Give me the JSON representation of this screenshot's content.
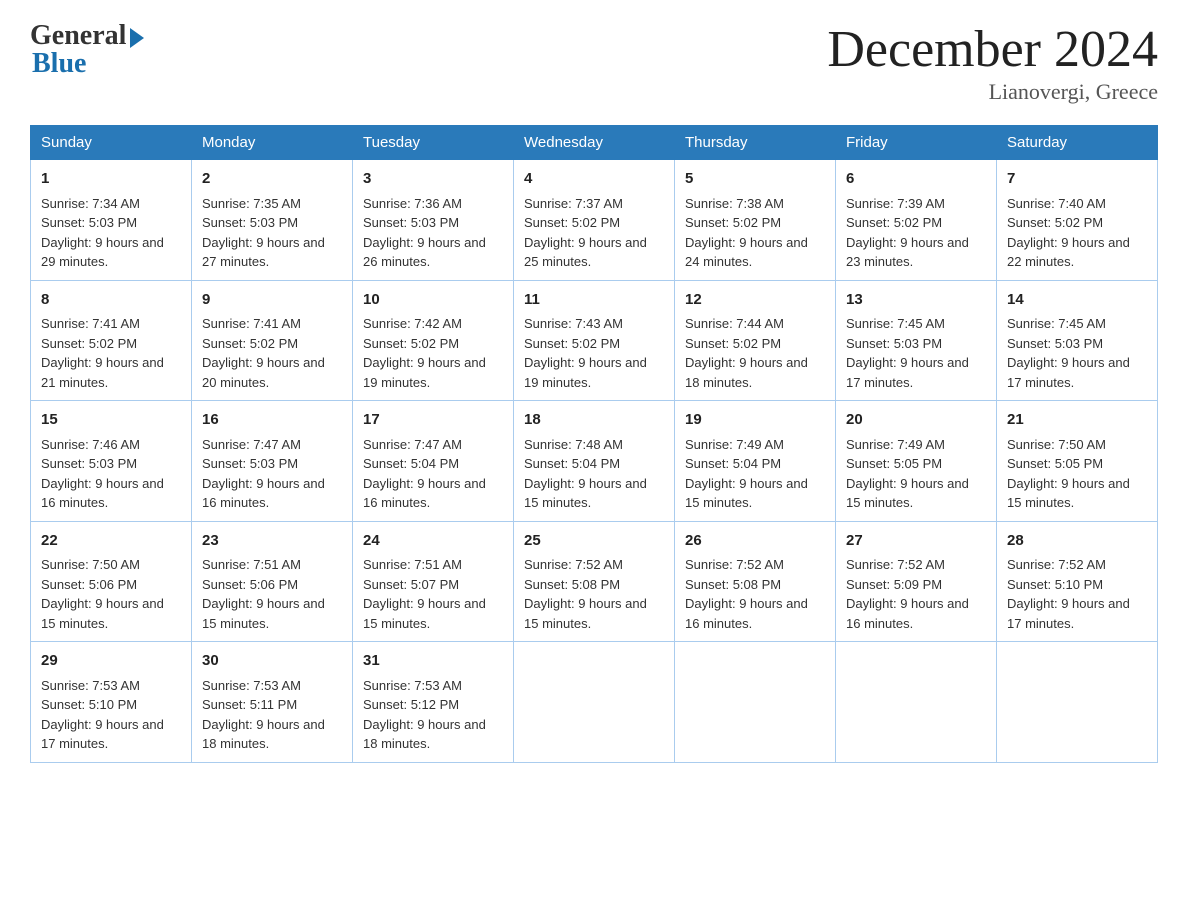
{
  "logo": {
    "general": "General",
    "blue": "Blue"
  },
  "title": "December 2024",
  "location": "Lianovergi, Greece",
  "headers": [
    "Sunday",
    "Monday",
    "Tuesday",
    "Wednesday",
    "Thursday",
    "Friday",
    "Saturday"
  ],
  "weeks": [
    [
      {
        "day": "1",
        "sunrise": "7:34 AM",
        "sunset": "5:03 PM",
        "daylight": "9 hours and 29 minutes."
      },
      {
        "day": "2",
        "sunrise": "7:35 AM",
        "sunset": "5:03 PM",
        "daylight": "9 hours and 27 minutes."
      },
      {
        "day": "3",
        "sunrise": "7:36 AM",
        "sunset": "5:03 PM",
        "daylight": "9 hours and 26 minutes."
      },
      {
        "day": "4",
        "sunrise": "7:37 AM",
        "sunset": "5:02 PM",
        "daylight": "9 hours and 25 minutes."
      },
      {
        "day": "5",
        "sunrise": "7:38 AM",
        "sunset": "5:02 PM",
        "daylight": "9 hours and 24 minutes."
      },
      {
        "day": "6",
        "sunrise": "7:39 AM",
        "sunset": "5:02 PM",
        "daylight": "9 hours and 23 minutes."
      },
      {
        "day": "7",
        "sunrise": "7:40 AM",
        "sunset": "5:02 PM",
        "daylight": "9 hours and 22 minutes."
      }
    ],
    [
      {
        "day": "8",
        "sunrise": "7:41 AM",
        "sunset": "5:02 PM",
        "daylight": "9 hours and 21 minutes."
      },
      {
        "day": "9",
        "sunrise": "7:41 AM",
        "sunset": "5:02 PM",
        "daylight": "9 hours and 20 minutes."
      },
      {
        "day": "10",
        "sunrise": "7:42 AM",
        "sunset": "5:02 PM",
        "daylight": "9 hours and 19 minutes."
      },
      {
        "day": "11",
        "sunrise": "7:43 AM",
        "sunset": "5:02 PM",
        "daylight": "9 hours and 19 minutes."
      },
      {
        "day": "12",
        "sunrise": "7:44 AM",
        "sunset": "5:02 PM",
        "daylight": "9 hours and 18 minutes."
      },
      {
        "day": "13",
        "sunrise": "7:45 AM",
        "sunset": "5:03 PM",
        "daylight": "9 hours and 17 minutes."
      },
      {
        "day": "14",
        "sunrise": "7:45 AM",
        "sunset": "5:03 PM",
        "daylight": "9 hours and 17 minutes."
      }
    ],
    [
      {
        "day": "15",
        "sunrise": "7:46 AM",
        "sunset": "5:03 PM",
        "daylight": "9 hours and 16 minutes."
      },
      {
        "day": "16",
        "sunrise": "7:47 AM",
        "sunset": "5:03 PM",
        "daylight": "9 hours and 16 minutes."
      },
      {
        "day": "17",
        "sunrise": "7:47 AM",
        "sunset": "5:04 PM",
        "daylight": "9 hours and 16 minutes."
      },
      {
        "day": "18",
        "sunrise": "7:48 AM",
        "sunset": "5:04 PM",
        "daylight": "9 hours and 15 minutes."
      },
      {
        "day": "19",
        "sunrise": "7:49 AM",
        "sunset": "5:04 PM",
        "daylight": "9 hours and 15 minutes."
      },
      {
        "day": "20",
        "sunrise": "7:49 AM",
        "sunset": "5:05 PM",
        "daylight": "9 hours and 15 minutes."
      },
      {
        "day": "21",
        "sunrise": "7:50 AM",
        "sunset": "5:05 PM",
        "daylight": "9 hours and 15 minutes."
      }
    ],
    [
      {
        "day": "22",
        "sunrise": "7:50 AM",
        "sunset": "5:06 PM",
        "daylight": "9 hours and 15 minutes."
      },
      {
        "day": "23",
        "sunrise": "7:51 AM",
        "sunset": "5:06 PM",
        "daylight": "9 hours and 15 minutes."
      },
      {
        "day": "24",
        "sunrise": "7:51 AM",
        "sunset": "5:07 PM",
        "daylight": "9 hours and 15 minutes."
      },
      {
        "day": "25",
        "sunrise": "7:52 AM",
        "sunset": "5:08 PM",
        "daylight": "9 hours and 15 minutes."
      },
      {
        "day": "26",
        "sunrise": "7:52 AM",
        "sunset": "5:08 PM",
        "daylight": "9 hours and 16 minutes."
      },
      {
        "day": "27",
        "sunrise": "7:52 AM",
        "sunset": "5:09 PM",
        "daylight": "9 hours and 16 minutes."
      },
      {
        "day": "28",
        "sunrise": "7:52 AM",
        "sunset": "5:10 PM",
        "daylight": "9 hours and 17 minutes."
      }
    ],
    [
      {
        "day": "29",
        "sunrise": "7:53 AM",
        "sunset": "5:10 PM",
        "daylight": "9 hours and 17 minutes."
      },
      {
        "day": "30",
        "sunrise": "7:53 AM",
        "sunset": "5:11 PM",
        "daylight": "9 hours and 18 minutes."
      },
      {
        "day": "31",
        "sunrise": "7:53 AM",
        "sunset": "5:12 PM",
        "daylight": "9 hours and 18 minutes."
      },
      null,
      null,
      null,
      null
    ]
  ]
}
